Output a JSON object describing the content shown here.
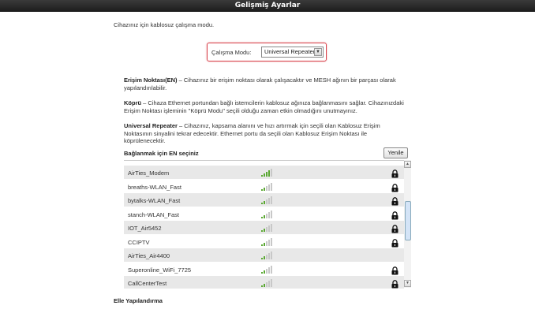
{
  "header": {
    "title": "Gelişmiş Ayarlar"
  },
  "intro_text": "Cihazınız için kablosuz çalışma modu.",
  "mode": {
    "label": "Çalışma Modu:",
    "selected": "Universal Repeater"
  },
  "descriptions": [
    {
      "title": "Erişim Noktası(EN)",
      "text": " – Cihazınız bir erişim noktası olarak çalışacaktır ve MESH ağının bir parçası olarak yapılandırılabilir."
    },
    {
      "title": "Köprü",
      "text": " – Cihaza Ethernet portundan bağlı istemcilerin kablosuz ağınıza bağlanmasını sağlar. Cihazınızdaki Erişim Noktası işleminin \"Köprü Modu\" seçili olduğu zaman etkin olmadığını unutmayınız."
    },
    {
      "title": "Universal Repeater",
      "text": " – Cihazınız, kapsama alanını ve hızı artırmak için seçili olan Kablosuz Erişim Noktasının sinyalini tekrar edecektir. Ethernet portu da seçili olan Kablosuz Erişim Noktası ile köprülenecektir."
    }
  ],
  "ap_list": {
    "title": "Bağlanmak için EN seçiniz",
    "refresh_label": "Yenile",
    "networks": [
      {
        "ssid": "AirTies_Modem",
        "locked": true,
        "signal": 4
      },
      {
        "ssid": "breaths-WLAN_Fast",
        "locked": true,
        "signal": 2
      },
      {
        "ssid": "bytalks-WLAN_Fast",
        "locked": true,
        "signal": 2
      },
      {
        "ssid": "stanch-WLAN_Fast",
        "locked": true,
        "signal": 2
      },
      {
        "ssid": "IOT_Air5452",
        "locked": true,
        "signal": 2
      },
      {
        "ssid": "CCIPTV",
        "locked": true,
        "signal": 2
      },
      {
        "ssid": "AirTies_Air4400",
        "locked": false,
        "signal": 2
      },
      {
        "ssid": "Superonline_WiFi_7725",
        "locked": true,
        "signal": 2
      },
      {
        "ssid": "CallCenterTest",
        "locked": true,
        "signal": 2
      }
    ]
  },
  "manual_config_title": "Elle Yapılandırma",
  "colors": {
    "signal_on": "#5aa832",
    "signal_off": "#c8c8c8",
    "highlight_border": "#d8404a"
  }
}
